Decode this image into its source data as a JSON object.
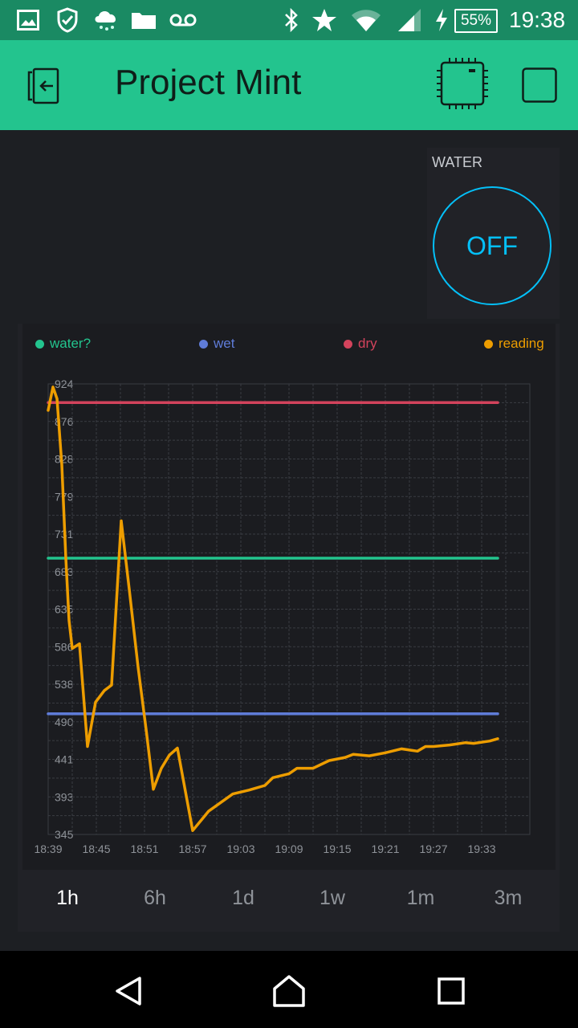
{
  "status_bar": {
    "battery_percent": "55%",
    "time": "19:38",
    "icons": [
      "gallery-icon",
      "shield-check-icon",
      "weather-icon",
      "folder-icon",
      "voicemail-icon",
      "bluetooth-icon",
      "star-icon",
      "wifi-icon",
      "signal-icon",
      "charging-icon"
    ]
  },
  "app_bar": {
    "title": "Project Mint",
    "icons": [
      "exit-icon",
      "device-chip-icon",
      "stop-square-icon"
    ]
  },
  "water_widget": {
    "label": "WATER",
    "state": "OFF",
    "color": "#04c0f8"
  },
  "chart_data": {
    "type": "line",
    "legend": [
      {
        "name": "water?",
        "color": "#23c48e"
      },
      {
        "name": "wet",
        "color": "#5f7cd8"
      },
      {
        "name": "dry",
        "color": "#d3435c"
      },
      {
        "name": "reading",
        "color": "#ed9d00"
      }
    ],
    "y_ticks": [
      "924",
      "876",
      "828",
      "779",
      "731",
      "683",
      "635",
      "586",
      "538",
      "490",
      "441",
      "393",
      "345"
    ],
    "ylim": [
      345,
      924
    ],
    "x_ticks": [
      "18:39",
      "18:45",
      "18:51",
      "18:57",
      "19:03",
      "19:09",
      "19:15",
      "19:21",
      "19:27",
      "19:33"
    ],
    "xlim_minutes": [
      0,
      60
    ],
    "grid": true,
    "series": [
      {
        "name": "dry",
        "color": "#d3435c",
        "points": [
          [
            0,
            900
          ],
          [
            56,
            900
          ]
        ]
      },
      {
        "name": "water?",
        "color": "#23c48e",
        "points": [
          [
            0,
            700
          ],
          [
            56,
            700
          ]
        ]
      },
      {
        "name": "wet",
        "color": "#5f7cd8",
        "points": [
          [
            0,
            500
          ],
          [
            56,
            500
          ]
        ]
      },
      {
        "name": "reading",
        "color": "#ed9d00",
        "points": [
          [
            0,
            890
          ],
          [
            0.6,
            920
          ],
          [
            1.1,
            905
          ],
          [
            1.7,
            820
          ],
          [
            2.2,
            700
          ],
          [
            2.6,
            620
          ],
          [
            3.0,
            584
          ],
          [
            3.9,
            590
          ],
          [
            4.9,
            458
          ],
          [
            5.9,
            515
          ],
          [
            7.0,
            530
          ],
          [
            7.9,
            537
          ],
          [
            9.1,
            748
          ],
          [
            10.1,
            660
          ],
          [
            11.2,
            560
          ],
          [
            12.2,
            480
          ],
          [
            13.1,
            403
          ],
          [
            14.1,
            430
          ],
          [
            15.1,
            447
          ],
          [
            16.1,
            456
          ],
          [
            18.0,
            350
          ],
          [
            20.0,
            375
          ],
          [
            23.0,
            397
          ],
          [
            25.0,
            402
          ],
          [
            27.0,
            408
          ],
          [
            28.0,
            418
          ],
          [
            30.0,
            423
          ],
          [
            31.0,
            430
          ],
          [
            33.0,
            430
          ],
          [
            35.0,
            440
          ],
          [
            37.0,
            444
          ],
          [
            38.0,
            448
          ],
          [
            40.0,
            446
          ],
          [
            42.0,
            450
          ],
          [
            44.0,
            455
          ],
          [
            46.0,
            452
          ],
          [
            47.0,
            458
          ],
          [
            48.0,
            458
          ],
          [
            50.0,
            460
          ],
          [
            52.0,
            463
          ],
          [
            53.0,
            462
          ],
          [
            55.0,
            465
          ],
          [
            56.0,
            468
          ]
        ]
      }
    ]
  },
  "ranges": {
    "options": [
      "1h",
      "6h",
      "1d",
      "1w",
      "1m",
      "3m"
    ],
    "selected": "1h"
  }
}
